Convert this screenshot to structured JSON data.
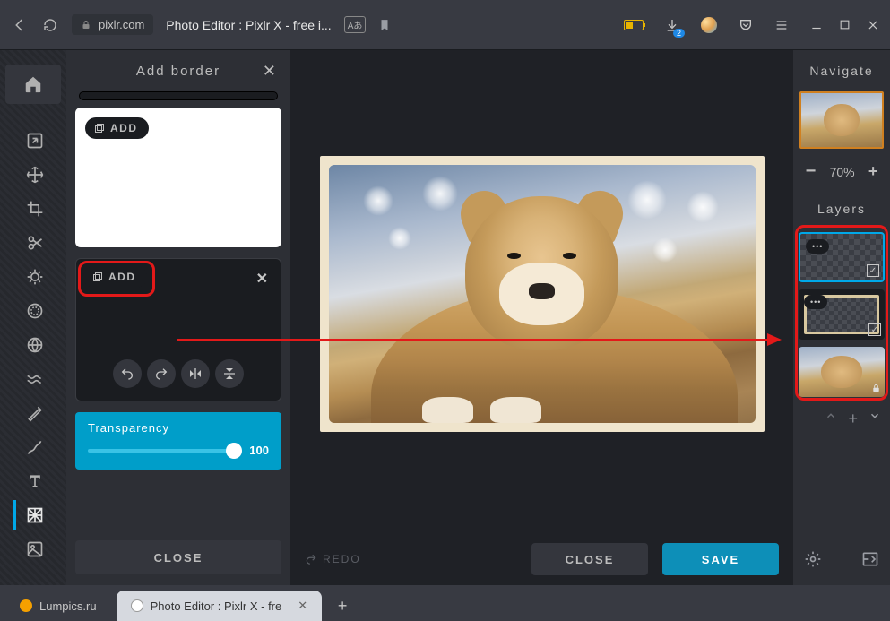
{
  "browser": {
    "domain": "pixlr.com",
    "page_title": "Photo Editor : Pixlr X - free i...",
    "translate_label": "Aあ",
    "download_badge": "2"
  },
  "panel": {
    "title": "Add border",
    "add_label_1": "ADD",
    "add_label_2": "ADD",
    "transparency": {
      "label": "Transparency",
      "value": "100"
    },
    "close_label": "CLOSE"
  },
  "canvas_actions": {
    "redo": "REDO",
    "close": "CLOSE",
    "save": "SAVE"
  },
  "right": {
    "navigate": "Navigate",
    "zoom": "70%",
    "layers_title": "Layers",
    "dots": "•••"
  },
  "tabs": {
    "t1": "Lumpics.ru",
    "t2": "Photo Editor : Pixlr X - fre"
  }
}
